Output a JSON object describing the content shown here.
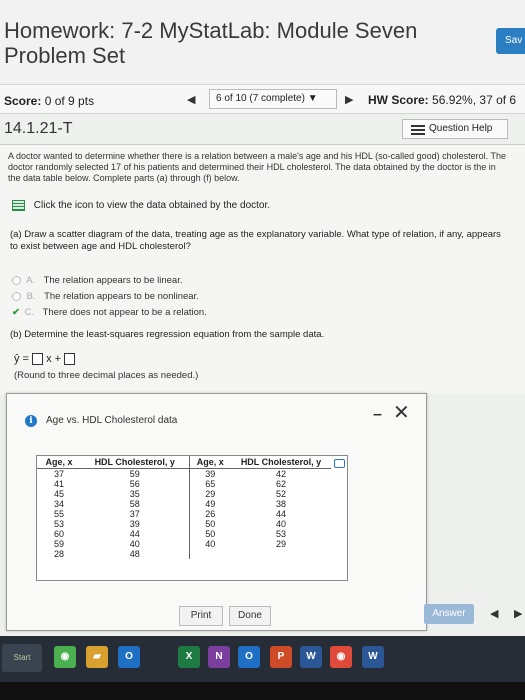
{
  "header": {
    "title": "Homework: 7-2 MyStatLab: Module Seven Problem Set",
    "save_label": "Sav"
  },
  "scorebar": {
    "score_label": "Score:",
    "score_value": "0 of 9 pts",
    "nav_prev": "◀",
    "nav_status": "6 of 10 (7 complete) ▼",
    "nav_next": "▶",
    "hw_score_label": "HW Score:",
    "hw_score_value": "56.92%, 37 of 6"
  },
  "question": {
    "id": "14.1.21-T",
    "help_label": "Question Help",
    "intro": "A doctor wanted to determine whether there is a relation between a male's age and his HDL (so-called good) cholesterol. The doctor randomly selected 17 of his patients and determined their HDL cholesterol. The data obtained by the doctor is the in the data table below. Complete parts (a) through (f) below.",
    "data_link": "Click the icon to view the data obtained by the doctor.",
    "part_a": "(a) Draw a scatter diagram of the data, treating age as the explanatory variable. What type of relation, if any, appears to exist between age and HDL cholesterol?",
    "options": [
      {
        "letter": "A.",
        "text": "The relation appears to be linear."
      },
      {
        "letter": "B.",
        "text": "The relation appears to be nonlinear."
      },
      {
        "letter": "C.",
        "text": "There does not appear to be a relation."
      }
    ],
    "selected_option": "C",
    "part_b": "(b) Determine the least-squares regression equation from the sample data.",
    "eqn_lhs": "ŷ =",
    "eqn_mid": "x +",
    "eqn_note": "(Round to three decimal places as needed.)"
  },
  "dialog": {
    "title": "Age vs. HDL Cholesterol data",
    "minimize": "–",
    "close": "✕",
    "headers": [
      "Age, x",
      "HDL Cholesterol, y",
      "Age, x",
      "HDL Cholesterol, y"
    ],
    "rows": [
      [
        "37",
        "59",
        "39",
        "42"
      ],
      [
        "41",
        "56",
        "65",
        "62"
      ],
      [
        "45",
        "35",
        "29",
        "52"
      ],
      [
        "34",
        "58",
        "49",
        "38"
      ],
      [
        "55",
        "37",
        "26",
        "44"
      ],
      [
        "53",
        "39",
        "50",
        "40"
      ],
      [
        "60",
        "44",
        "50",
        "53"
      ],
      [
        "59",
        "40",
        "40",
        "29"
      ],
      [
        "28",
        "48",
        "",
        ""
      ]
    ],
    "print_label": "Print",
    "done_label": "Done"
  },
  "answer_label": "Answer",
  "taskbar": {
    "start_label": "Start",
    "apps": [
      {
        "name": "chrome-icon",
        "glyph": "◉",
        "color": "#4caf50"
      },
      {
        "name": "folder-icon",
        "glyph": "▰",
        "color": "#d8a130"
      },
      {
        "name": "outlook-icon",
        "glyph": "O",
        "color": "#1f6fc4"
      },
      {
        "name": "excel-icon",
        "glyph": "X",
        "color": "#1e7a43"
      },
      {
        "name": "onenote-icon",
        "glyph": "N",
        "color": "#7b3fa0"
      },
      {
        "name": "outlook2-icon",
        "glyph": "O",
        "color": "#1f6fc4"
      },
      {
        "name": "powerpoint-icon",
        "glyph": "P",
        "color": "#cf4a26"
      },
      {
        "name": "word-icon",
        "glyph": "W",
        "color": "#2b5797"
      },
      {
        "name": "chrome2-icon",
        "glyph": "◉",
        "color": "#e04a3a"
      },
      {
        "name": "word2-icon",
        "glyph": "W",
        "color": "#2b5797"
      }
    ]
  }
}
